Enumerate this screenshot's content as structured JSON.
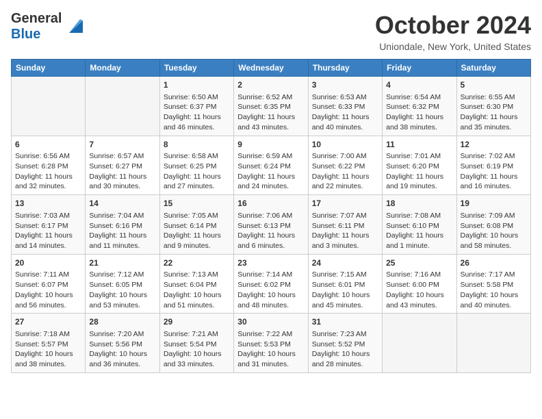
{
  "header": {
    "logo_line1": "General",
    "logo_line2": "Blue",
    "month": "October 2024",
    "location": "Uniondale, New York, United States"
  },
  "weekdays": [
    "Sunday",
    "Monday",
    "Tuesday",
    "Wednesday",
    "Thursday",
    "Friday",
    "Saturday"
  ],
  "weeks": [
    [
      {
        "day": "",
        "info": ""
      },
      {
        "day": "",
        "info": ""
      },
      {
        "day": "1",
        "info": "Sunrise: 6:50 AM\nSunset: 6:37 PM\nDaylight: 11 hours and 46 minutes."
      },
      {
        "day": "2",
        "info": "Sunrise: 6:52 AM\nSunset: 6:35 PM\nDaylight: 11 hours and 43 minutes."
      },
      {
        "day": "3",
        "info": "Sunrise: 6:53 AM\nSunset: 6:33 PM\nDaylight: 11 hours and 40 minutes."
      },
      {
        "day": "4",
        "info": "Sunrise: 6:54 AM\nSunset: 6:32 PM\nDaylight: 11 hours and 38 minutes."
      },
      {
        "day": "5",
        "info": "Sunrise: 6:55 AM\nSunset: 6:30 PM\nDaylight: 11 hours and 35 minutes."
      }
    ],
    [
      {
        "day": "6",
        "info": "Sunrise: 6:56 AM\nSunset: 6:28 PM\nDaylight: 11 hours and 32 minutes."
      },
      {
        "day": "7",
        "info": "Sunrise: 6:57 AM\nSunset: 6:27 PM\nDaylight: 11 hours and 30 minutes."
      },
      {
        "day": "8",
        "info": "Sunrise: 6:58 AM\nSunset: 6:25 PM\nDaylight: 11 hours and 27 minutes."
      },
      {
        "day": "9",
        "info": "Sunrise: 6:59 AM\nSunset: 6:24 PM\nDaylight: 11 hours and 24 minutes."
      },
      {
        "day": "10",
        "info": "Sunrise: 7:00 AM\nSunset: 6:22 PM\nDaylight: 11 hours and 22 minutes."
      },
      {
        "day": "11",
        "info": "Sunrise: 7:01 AM\nSunset: 6:20 PM\nDaylight: 11 hours and 19 minutes."
      },
      {
        "day": "12",
        "info": "Sunrise: 7:02 AM\nSunset: 6:19 PM\nDaylight: 11 hours and 16 minutes."
      }
    ],
    [
      {
        "day": "13",
        "info": "Sunrise: 7:03 AM\nSunset: 6:17 PM\nDaylight: 11 hours and 14 minutes."
      },
      {
        "day": "14",
        "info": "Sunrise: 7:04 AM\nSunset: 6:16 PM\nDaylight: 11 hours and 11 minutes."
      },
      {
        "day": "15",
        "info": "Sunrise: 7:05 AM\nSunset: 6:14 PM\nDaylight: 11 hours and 9 minutes."
      },
      {
        "day": "16",
        "info": "Sunrise: 7:06 AM\nSunset: 6:13 PM\nDaylight: 11 hours and 6 minutes."
      },
      {
        "day": "17",
        "info": "Sunrise: 7:07 AM\nSunset: 6:11 PM\nDaylight: 11 hours and 3 minutes."
      },
      {
        "day": "18",
        "info": "Sunrise: 7:08 AM\nSunset: 6:10 PM\nDaylight: 11 hours and 1 minute."
      },
      {
        "day": "19",
        "info": "Sunrise: 7:09 AM\nSunset: 6:08 PM\nDaylight: 10 hours and 58 minutes."
      }
    ],
    [
      {
        "day": "20",
        "info": "Sunrise: 7:11 AM\nSunset: 6:07 PM\nDaylight: 10 hours and 56 minutes."
      },
      {
        "day": "21",
        "info": "Sunrise: 7:12 AM\nSunset: 6:05 PM\nDaylight: 10 hours and 53 minutes."
      },
      {
        "day": "22",
        "info": "Sunrise: 7:13 AM\nSunset: 6:04 PM\nDaylight: 10 hours and 51 minutes."
      },
      {
        "day": "23",
        "info": "Sunrise: 7:14 AM\nSunset: 6:02 PM\nDaylight: 10 hours and 48 minutes."
      },
      {
        "day": "24",
        "info": "Sunrise: 7:15 AM\nSunset: 6:01 PM\nDaylight: 10 hours and 45 minutes."
      },
      {
        "day": "25",
        "info": "Sunrise: 7:16 AM\nSunset: 6:00 PM\nDaylight: 10 hours and 43 minutes."
      },
      {
        "day": "26",
        "info": "Sunrise: 7:17 AM\nSunset: 5:58 PM\nDaylight: 10 hours and 40 minutes."
      }
    ],
    [
      {
        "day": "27",
        "info": "Sunrise: 7:18 AM\nSunset: 5:57 PM\nDaylight: 10 hours and 38 minutes."
      },
      {
        "day": "28",
        "info": "Sunrise: 7:20 AM\nSunset: 5:56 PM\nDaylight: 10 hours and 36 minutes."
      },
      {
        "day": "29",
        "info": "Sunrise: 7:21 AM\nSunset: 5:54 PM\nDaylight: 10 hours and 33 minutes."
      },
      {
        "day": "30",
        "info": "Sunrise: 7:22 AM\nSunset: 5:53 PM\nDaylight: 10 hours and 31 minutes."
      },
      {
        "day": "31",
        "info": "Sunrise: 7:23 AM\nSunset: 5:52 PM\nDaylight: 10 hours and 28 minutes."
      },
      {
        "day": "",
        "info": ""
      },
      {
        "day": "",
        "info": ""
      }
    ]
  ]
}
